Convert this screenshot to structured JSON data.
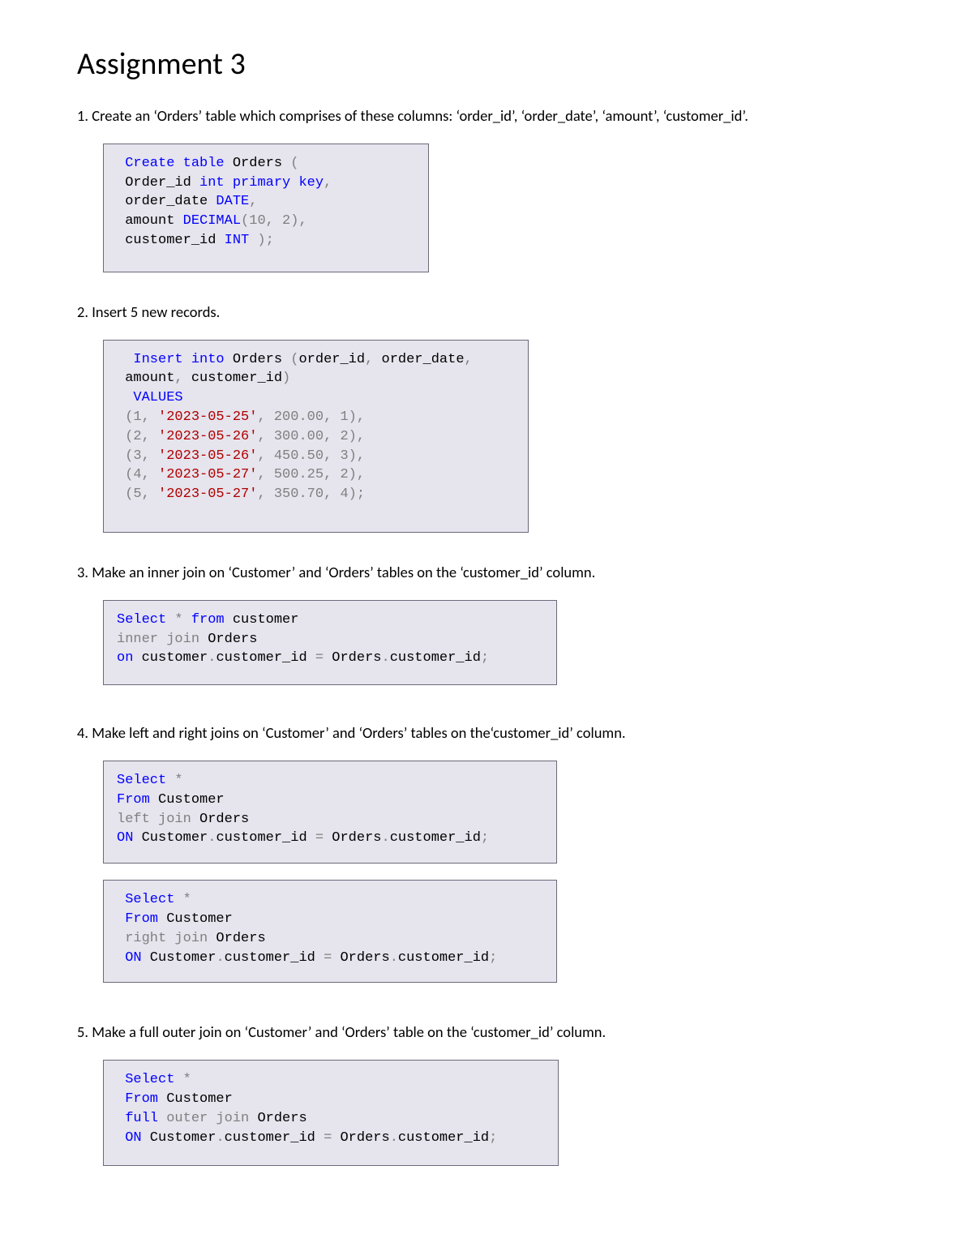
{
  "title": "Assignment 3",
  "q1": "1. Create an ‘Orders’ table which comprises of these columns: ‘order_id’, ‘order_date’, ‘amount’, ‘customer_id’.",
  "q2": " 2. Insert 5 new records.",
  "q3": "3. Make an inner join on ‘Customer’ and ‘Orders’ tables on the ‘customer_id’ column.",
  "q4": " 4. Make left and right joins on ‘Customer’ and ‘Orders’ tables on the‘customer_id’ column.",
  "q5": "5. Make a full outer join on ‘Customer’ and ‘Orders’ table on the ‘customer_id’ column.",
  "code1": {
    "t1a": " Create",
    "t1b": " table",
    "t1c": " Orders ",
    "t1d": "(",
    "t2a": " Order_id ",
    "t2b": "int",
    "t2c": " primary",
    "t2d": " key",
    "t2e": ",",
    "t3a": " order_date ",
    "t3b": "DATE",
    "t3c": ",",
    "t4a": " amount ",
    "t4b": "DECIMAL",
    "t4c": "(",
    "t4d": "10",
    "t4e": ",",
    "t4f": " 2",
    "t4g": "),",
    "t5a": " customer_id ",
    "t5b": "INT",
    "t5c": " );"
  },
  "code2": {
    "t1a": "  Insert",
    "t1b": " into",
    "t1c": " Orders ",
    "t1d": "(",
    "t1e": "order_id",
    "t1f": ",",
    "t1g": " order_date",
    "t1h": ",",
    "t2a": " amount",
    "t2b": ",",
    "t2c": " customer_id",
    "t2d": ")",
    "t3a": "  VALUES",
    "t4a": " (",
    "t4b": "1",
    "t4c": ",",
    "t4d": " '2023-05-25'",
    "t4e": ",",
    "t4f": " 200.00",
    "t4g": ",",
    "t4h": " 1",
    "t4i": "),",
    "t5a": " (",
    "t5b": "2",
    "t5c": ",",
    "t5d": " '2023-05-26'",
    "t5e": ",",
    "t5f": " 300.00",
    "t5g": ",",
    "t5h": " 2",
    "t5i": "),",
    "t6a": " (",
    "t6b": "3",
    "t6c": ",",
    "t6d": " '2023-05-26'",
    "t6e": ",",
    "t6f": " 450.50",
    "t6g": ",",
    "t6h": " 3",
    "t6i": "),",
    "t7a": " (",
    "t7b": "4",
    "t7c": ",",
    "t7d": " '2023-05-27'",
    "t7e": ",",
    "t7f": " 500.25",
    "t7g": ",",
    "t7h": " 2",
    "t7i": "),",
    "t8a": " (",
    "t8b": "5",
    "t8c": ",",
    "t8d": " '2023-05-27'",
    "t8e": ",",
    "t8f": " 350.70",
    "t8g": ",",
    "t8h": " 4",
    "t8i": ");"
  },
  "code3": {
    "t1a": "Select",
    "t1b": " *",
    "t1c": " from",
    "t1d": " customer",
    "t2a": "inner",
    "t2b": " join",
    "t2c": " Orders",
    "t3a": "on",
    "t3b": " customer",
    "t3c": ".",
    "t3d": "customer_id ",
    "t3e": "=",
    "t3f": " Orders",
    "t3g": ".",
    "t3h": "customer_id",
    "t3i": ";"
  },
  "code4": {
    "t1a": "Select",
    "t1b": " *",
    "t2a": "From",
    "t2b": " Customer",
    "t3a": "left",
    "t3b": " join",
    "t3c": " Orders",
    "t4a": "ON",
    "t4b": " Customer",
    "t4c": ".",
    "t4d": "customer_id ",
    "t4e": "=",
    "t4f": " Orders",
    "t4g": ".",
    "t4h": "customer_id",
    "t4i": ";"
  },
  "code5": {
    "t1a": " Select",
    "t1b": " *",
    "t2a": " From",
    "t2b": " Customer",
    "t3a": " right",
    "t3b": " join",
    "t3c": " Orders",
    "t4a": " ON",
    "t4b": " Customer",
    "t4c": ".",
    "t4d": "customer_id ",
    "t4e": "=",
    "t4f": " Orders",
    "t4g": ".",
    "t4h": "customer_id",
    "t4i": ";"
  },
  "code6": {
    "t1a": " Select",
    "t1b": " *",
    "t2a": " From",
    "t2b": " Customer",
    "t3a": " full",
    "t3b": " outer",
    "t3c": " join",
    "t3d": " Orders",
    "t4a": " ON",
    "t4b": " Customer",
    "t4c": ".",
    "t4d": "customer_id ",
    "t4e": "=",
    "t4f": " Orders",
    "t4g": ".",
    "t4h": "customer_id",
    "t4i": ";"
  }
}
